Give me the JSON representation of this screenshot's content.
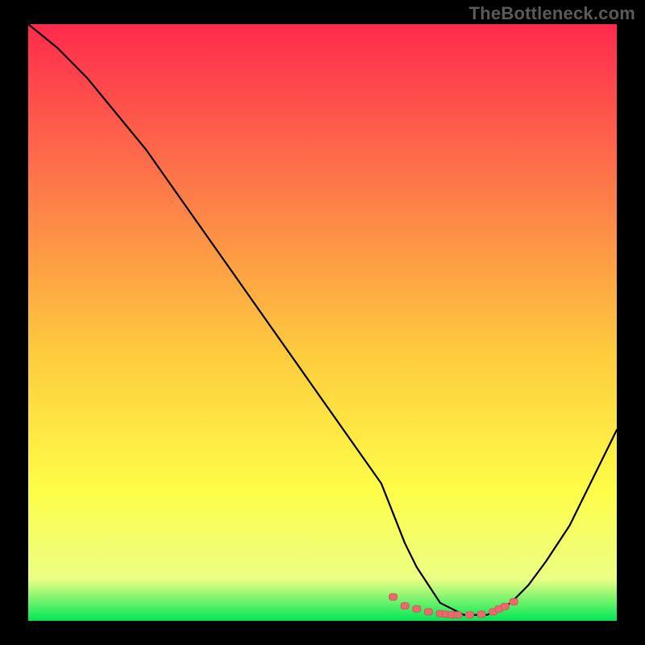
{
  "watermark": "TheBottleneck.com",
  "colors": {
    "frame_bg": "#000000",
    "watermark": "#5a5a5a",
    "curve": "#000000",
    "marker_fill": "#e96a6c",
    "marker_stroke": "#d4595c",
    "gradient_top": "#ff2a4d",
    "gradient_mid1": "#fd7b49",
    "gradient_mid2": "#fecb3e",
    "gradient_mid3": "#fefd47",
    "gradient_mid4": "#ecff85",
    "gradient_bottom": "#00e756"
  },
  "chart_data": {
    "type": "line",
    "title": "",
    "xlabel": "",
    "ylabel": "",
    "xlim": [
      0,
      100
    ],
    "ylim": [
      0,
      100
    ],
    "series": [
      {
        "name": "bottleneck-curve",
        "x": [
          0,
          5,
          10,
          15,
          20,
          25,
          30,
          35,
          40,
          45,
          50,
          55,
          60,
          62,
          64,
          66,
          68,
          70,
          72,
          74,
          76,
          78,
          80,
          82,
          85,
          88,
          92,
          96,
          100
        ],
        "values": [
          100,
          96,
          91,
          85,
          79,
          72,
          65,
          58,
          51,
          44,
          37,
          30,
          23,
          18,
          13,
          9,
          6,
          3,
          2,
          1,
          1,
          1,
          2,
          3,
          6,
          10,
          16,
          24,
          32
        ]
      }
    ],
    "markers": {
      "name": "valley-dash-markers",
      "x": [
        62,
        64,
        66,
        68,
        70,
        71,
        72,
        73,
        75,
        77,
        79,
        80,
        81,
        82.5
      ],
      "values": [
        4,
        2.5,
        2,
        1.5,
        1.2,
        1.1,
        1.0,
        1.0,
        1.0,
        1.1,
        1.5,
        2.0,
        2.4,
        3.2
      ]
    }
  }
}
